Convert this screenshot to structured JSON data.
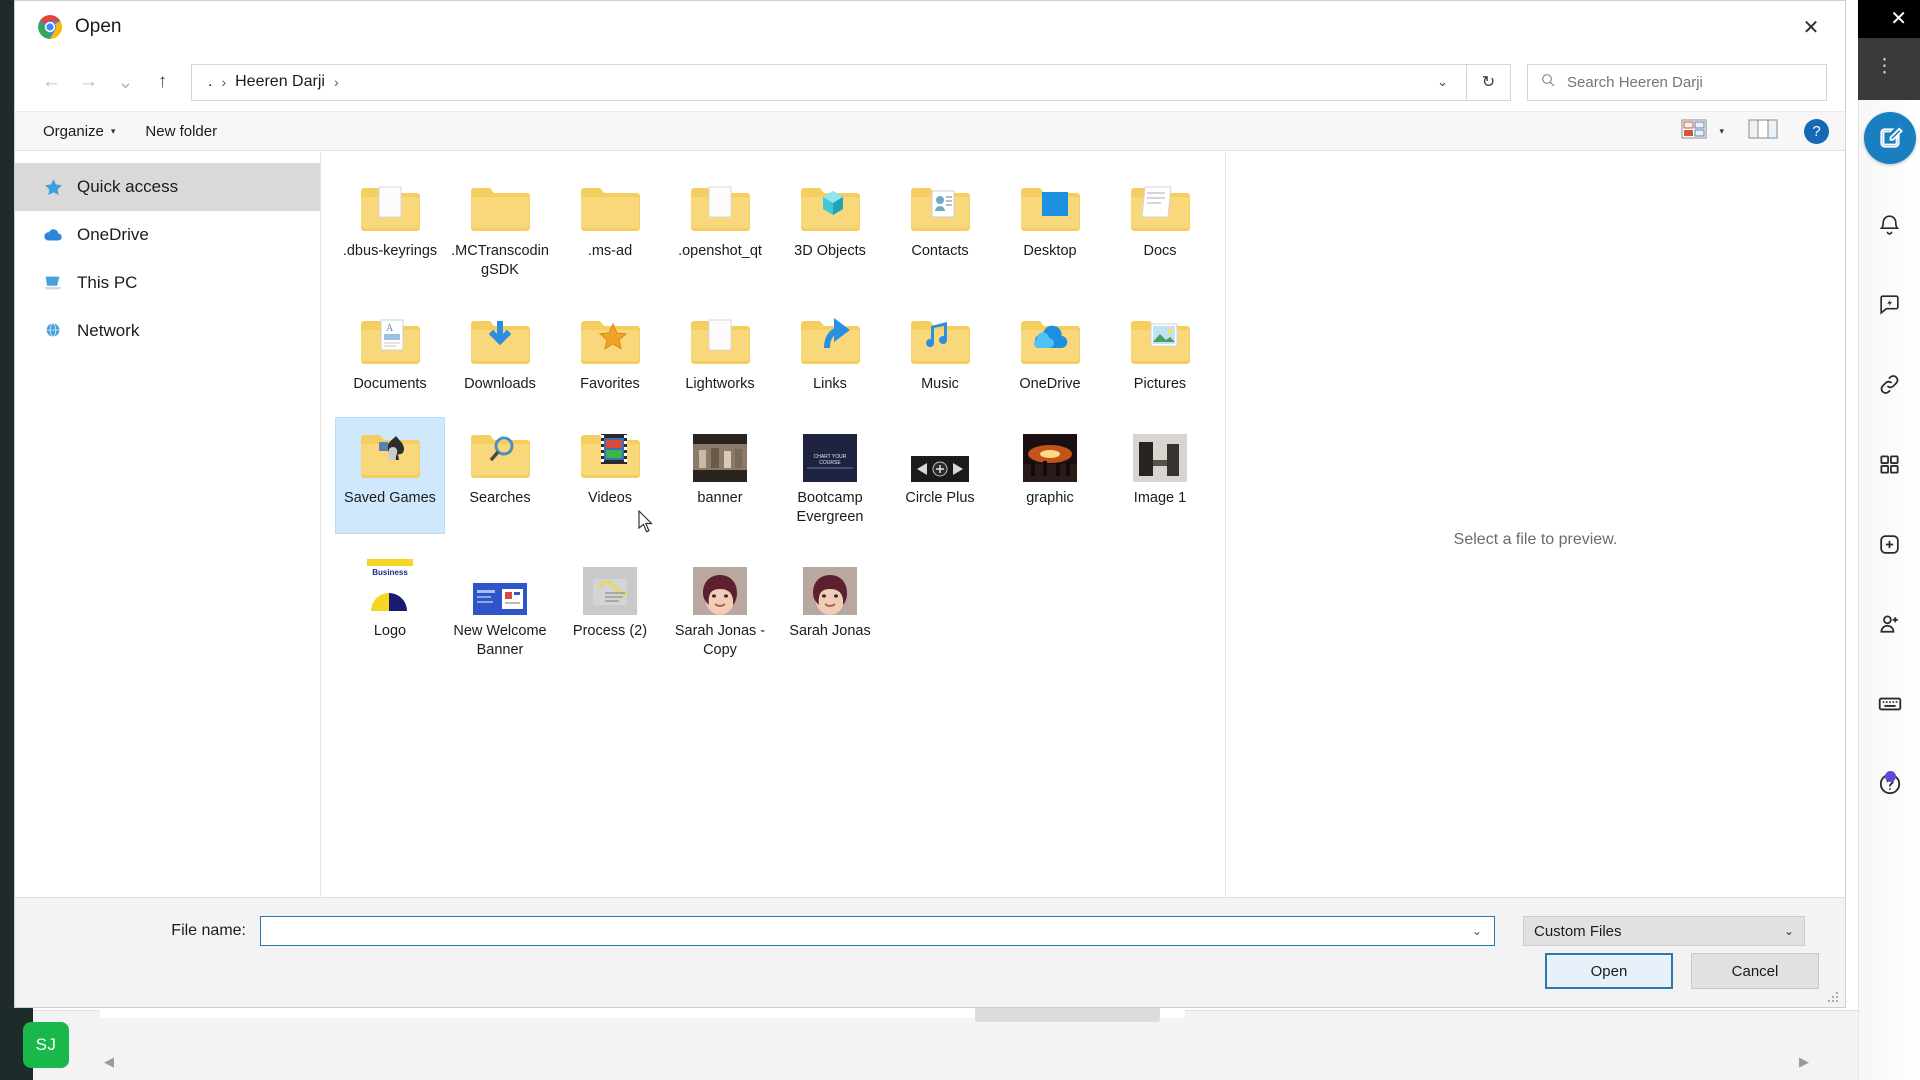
{
  "window": {
    "title": "Open",
    "app_icon": "chrome-icon",
    "close_label": "✕"
  },
  "nav": {
    "back_label": "←",
    "forward_label": "→",
    "recent_label": "⌄",
    "up_label": "↑",
    "breadcrumb": [
      ".",
      "Heeren Darji"
    ],
    "breadcrumb_separator": "›",
    "address_chevron": "⌄",
    "refresh_label": "↻"
  },
  "search": {
    "placeholder": "Search Heeren Darji",
    "icon": "search-icon"
  },
  "command_bar": {
    "organize_label": "Organize",
    "organize_caret": "▾",
    "new_folder_label": "New folder",
    "view_caret": "▾",
    "help_label": "?"
  },
  "sidebar": {
    "items": [
      {
        "label": "Quick access",
        "icon": "star-icon",
        "active": true
      },
      {
        "label": "OneDrive",
        "icon": "cloud-icon",
        "active": false
      },
      {
        "label": "This PC",
        "icon": "computer-icon",
        "active": false
      },
      {
        "label": "Network",
        "icon": "network-icon",
        "active": false
      }
    ]
  },
  "files": [
    {
      "name": ".dbus-keyrings",
      "type": "folder-doc",
      "selected": false
    },
    {
      "name": ".MCTranscodingSDK",
      "type": "folder",
      "selected": false
    },
    {
      "name": ".ms-ad",
      "type": "folder",
      "selected": false
    },
    {
      "name": ".openshot_qt",
      "type": "folder-doc",
      "selected": false
    },
    {
      "name": "3D Objects",
      "type": "folder-3d",
      "selected": false
    },
    {
      "name": "Contacts",
      "type": "folder-contacts",
      "selected": false
    },
    {
      "name": "Desktop",
      "type": "folder-desktop",
      "selected": false
    },
    {
      "name": "Docs",
      "type": "folder-docs",
      "selected": false
    },
    {
      "name": "Documents",
      "type": "folder-documents",
      "selected": false
    },
    {
      "name": "Downloads",
      "type": "folder-downloads",
      "selected": false
    },
    {
      "name": "Favorites",
      "type": "folder-favorites",
      "selected": false
    },
    {
      "name": "Lightworks",
      "type": "folder-doc",
      "selected": false
    },
    {
      "name": "Links",
      "type": "folder-links",
      "selected": false
    },
    {
      "name": "Music",
      "type": "folder-music",
      "selected": false
    },
    {
      "name": "OneDrive",
      "type": "folder-onedrive",
      "selected": false
    },
    {
      "name": "Pictures",
      "type": "folder-pictures",
      "selected": false
    },
    {
      "name": "Saved Games",
      "type": "folder-games",
      "selected": true
    },
    {
      "name": "Searches",
      "type": "folder-searches",
      "selected": false
    },
    {
      "name": "Videos",
      "type": "folder-videos",
      "selected": false
    },
    {
      "name": "banner",
      "type": "image-banner",
      "selected": false
    },
    {
      "name": "Bootcamp Evergreen",
      "type": "image-bootcamp",
      "thumb_text": "CHART YOUR COURSE",
      "selected": false
    },
    {
      "name": "Circle Plus",
      "type": "image-circleplus",
      "selected": false
    },
    {
      "name": "graphic",
      "type": "image-graphic",
      "selected": false
    },
    {
      "name": "Image 1",
      "type": "image-generic",
      "selected": false
    },
    {
      "name": "Logo",
      "type": "image-logo",
      "thumb_text": "Business",
      "selected": false
    },
    {
      "name": "New Welcome Banner",
      "type": "image-welcome",
      "selected": false
    },
    {
      "name": "Process (2)",
      "type": "image-process",
      "selected": false
    },
    {
      "name": "Sarah Jonas - Copy",
      "type": "image-portrait",
      "selected": false
    },
    {
      "name": "Sarah Jonas",
      "type": "image-portrait",
      "selected": false
    }
  ],
  "preview": {
    "empty_text": "Select a file to preview."
  },
  "footer": {
    "filename_label": "File name:",
    "filename_value": "",
    "filename_chevron": "⌄",
    "filter_value": "Custom Files",
    "filter_chevron": "⌄",
    "open_label": "Open",
    "cancel_label": "Cancel"
  },
  "right_rail": {
    "close_label": "✕",
    "menu_label": "⋮",
    "items": [
      {
        "icon": "compose-icon"
      },
      {
        "icon": "bell-icon"
      },
      {
        "icon": "lightning-chat-icon"
      },
      {
        "icon": "link-icon"
      },
      {
        "icon": "grid-icon"
      },
      {
        "icon": "add-square-icon"
      },
      {
        "icon": "add-person-icon"
      },
      {
        "icon": "keyboard-icon"
      },
      {
        "icon": "help-icon"
      }
    ]
  },
  "background": {
    "avatar_initials": "SJ",
    "scroll_left": "◀",
    "scroll_right": "▶"
  },
  "colors": {
    "accent": "#2a7ab0",
    "folder": "#f5ce62",
    "selection": "#cfe8fc",
    "rail_blue": "#1a7fc1",
    "help_blue": "#1669b5",
    "avatar_green": "#18b84a",
    "badge_purple": "#5b4bd6"
  }
}
